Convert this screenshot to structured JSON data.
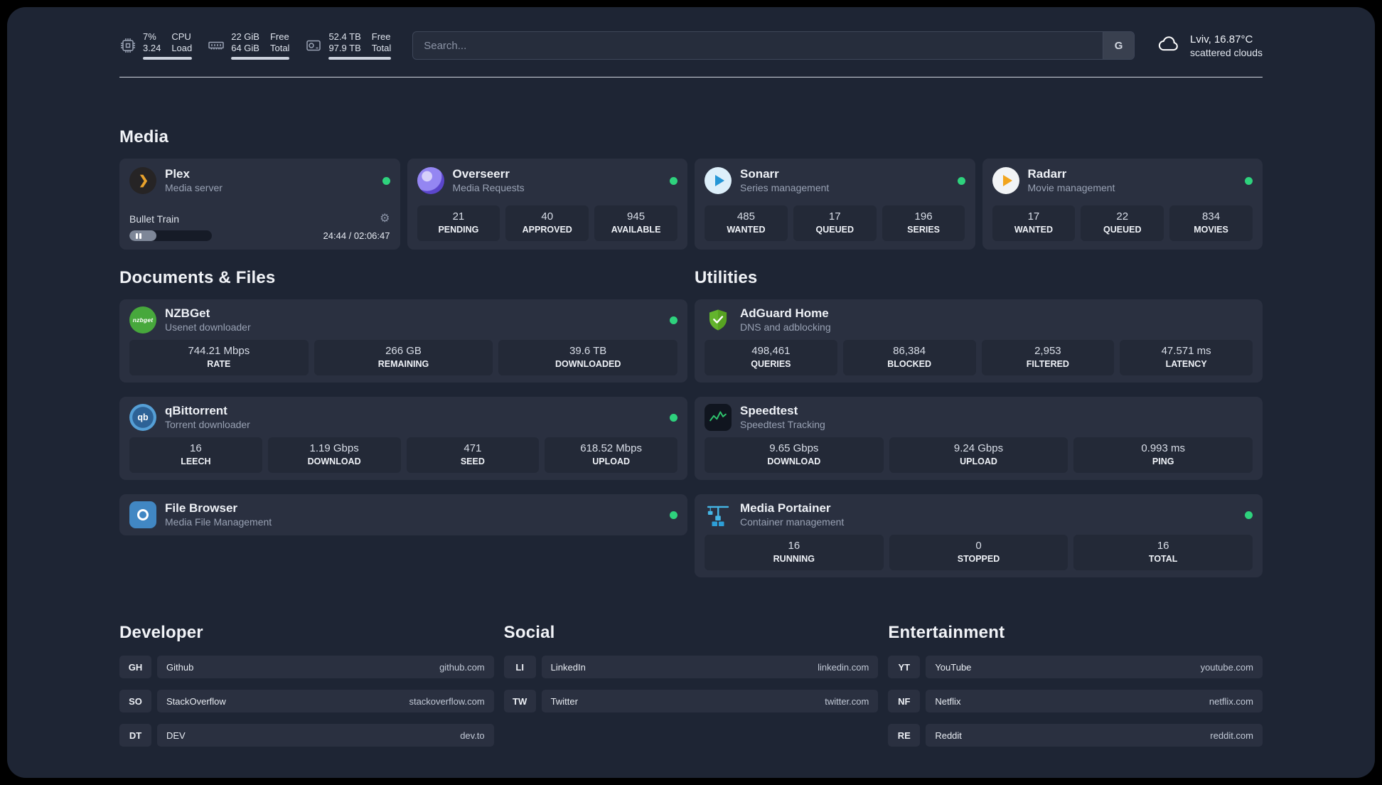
{
  "colors": {
    "status_online": "#2ed27d",
    "panel_bg": "#1e2534",
    "card_bg": "#2a3040",
    "tile_bg": "#232937",
    "plex_gold": "#e8a22c",
    "adguard_green": "#63b42d",
    "speedtest_green": "#2fc46e",
    "portainer_blue": "#45b6e6"
  },
  "topbar": {
    "system": [
      {
        "icon": "cpu-icon",
        "value_top": "7%",
        "value_bottom": "3.24",
        "label_top": "CPU",
        "label_bottom": "Load"
      },
      {
        "icon": "ram-icon",
        "value_top": "22 GiB",
        "value_bottom": "64 GiB",
        "label_top": "Free",
        "label_bottom": "Total"
      },
      {
        "icon": "disk-icon",
        "value_top": "52.4 TB",
        "value_bottom": "97.9 TB",
        "label_top": "Free",
        "label_bottom": "Total"
      }
    ],
    "search": {
      "placeholder": "Search...",
      "button_label": "G"
    },
    "weather": {
      "icon": "cloud-icon",
      "title": "Lviv, 16.87°C",
      "subtitle": "scattered clouds"
    }
  },
  "media": {
    "title": "Media",
    "plex": {
      "icon": "plex-icon",
      "name": "Plex",
      "subtitle": "Media server",
      "online": true,
      "now_playing": "Bullet Train",
      "time": "24:44 / 02:06:47"
    },
    "overseerr": {
      "icon": "overseerr-icon",
      "name": "Overseerr",
      "subtitle": "Media Requests",
      "online": true,
      "stats": [
        {
          "value": "21",
          "label": "PENDING"
        },
        {
          "value": "40",
          "label": "APPROVED"
        },
        {
          "value": "945",
          "label": "AVAILABLE"
        }
      ]
    },
    "sonarr": {
      "icon": "sonarr-icon",
      "name": "Sonarr",
      "subtitle": "Series management",
      "online": true,
      "stats": [
        {
          "value": "485",
          "label": "WANTED"
        },
        {
          "value": "17",
          "label": "QUEUED"
        },
        {
          "value": "196",
          "label": "SERIES"
        }
      ]
    },
    "radarr": {
      "icon": "radarr-icon",
      "name": "Radarr",
      "subtitle": "Movie management",
      "online": true,
      "stats": [
        {
          "value": "17",
          "label": "WANTED"
        },
        {
          "value": "22",
          "label": "QUEUED"
        },
        {
          "value": "834",
          "label": "MOVIES"
        }
      ]
    }
  },
  "documents": {
    "title": "Documents & Files",
    "nzbget": {
      "icon": "nzbget-icon",
      "icon_text": "nzbget",
      "name": "NZBGet",
      "subtitle": "Usenet downloader",
      "online": true,
      "stats": [
        {
          "value": "744.21 Mbps",
          "label": "RATE"
        },
        {
          "value": "266 GB",
          "label": "REMAINING"
        },
        {
          "value": "39.6 TB",
          "label": "DOWNLOADED"
        }
      ]
    },
    "qbittorrent": {
      "icon": "qbittorrent-icon",
      "icon_text": "qb",
      "name": "qBittorrent",
      "subtitle": "Torrent downloader",
      "online": true,
      "stats": [
        {
          "value": "16",
          "label": "LEECH"
        },
        {
          "value": "1.19 Gbps",
          "label": "DOWNLOAD"
        },
        {
          "value": "471",
          "label": "SEED"
        },
        {
          "value": "618.52 Mbps",
          "label": "UPLOAD"
        }
      ]
    },
    "filebrowser": {
      "icon": "filebrowser-icon",
      "name": "File Browser",
      "subtitle": "Media File Management",
      "online": true
    }
  },
  "utilities": {
    "title": "Utilities",
    "adguard": {
      "icon": "adguard-icon",
      "name": "AdGuard Home",
      "subtitle": "DNS and adblocking",
      "stats": [
        {
          "value": "498,461",
          "label": "QUERIES"
        },
        {
          "value": "86,384",
          "label": "BLOCKED"
        },
        {
          "value": "2,953",
          "label": "FILTERED"
        },
        {
          "value": "47.571 ms",
          "label": "LATENCY"
        }
      ]
    },
    "speedtest": {
      "icon": "speedtest-icon",
      "name": "Speedtest",
      "subtitle": "Speedtest Tracking",
      "stats": [
        {
          "value": "9.65 Gbps",
          "label": "DOWNLOAD"
        },
        {
          "value": "9.24 Gbps",
          "label": "UPLOAD"
        },
        {
          "value": "0.993 ms",
          "label": "PING"
        }
      ]
    },
    "portainer": {
      "icon": "portainer-icon",
      "name": "Media Portainer",
      "subtitle": "Container management",
      "online": true,
      "stats": [
        {
          "value": "16",
          "label": "RUNNING"
        },
        {
          "value": "0",
          "label": "STOPPED"
        },
        {
          "value": "16",
          "label": "TOTAL"
        }
      ]
    }
  },
  "bookmarks": {
    "developer": {
      "title": "Developer",
      "links": [
        {
          "abbr": "GH",
          "name": "Github",
          "url": "github.com"
        },
        {
          "abbr": "SO",
          "name": "StackOverflow",
          "url": "stackoverflow.com"
        },
        {
          "abbr": "DT",
          "name": "DEV",
          "url": "dev.to"
        }
      ]
    },
    "social": {
      "title": "Social",
      "links": [
        {
          "abbr": "LI",
          "name": "LinkedIn",
          "url": "linkedin.com"
        },
        {
          "abbr": "TW",
          "name": "Twitter",
          "url": "twitter.com"
        }
      ]
    },
    "entertainment": {
      "title": "Entertainment",
      "links": [
        {
          "abbr": "YT",
          "name": "YouTube",
          "url": "youtube.com"
        },
        {
          "abbr": "NF",
          "name": "Netflix",
          "url": "netflix.com"
        },
        {
          "abbr": "RE",
          "name": "Reddit",
          "url": "reddit.com"
        }
      ]
    }
  }
}
